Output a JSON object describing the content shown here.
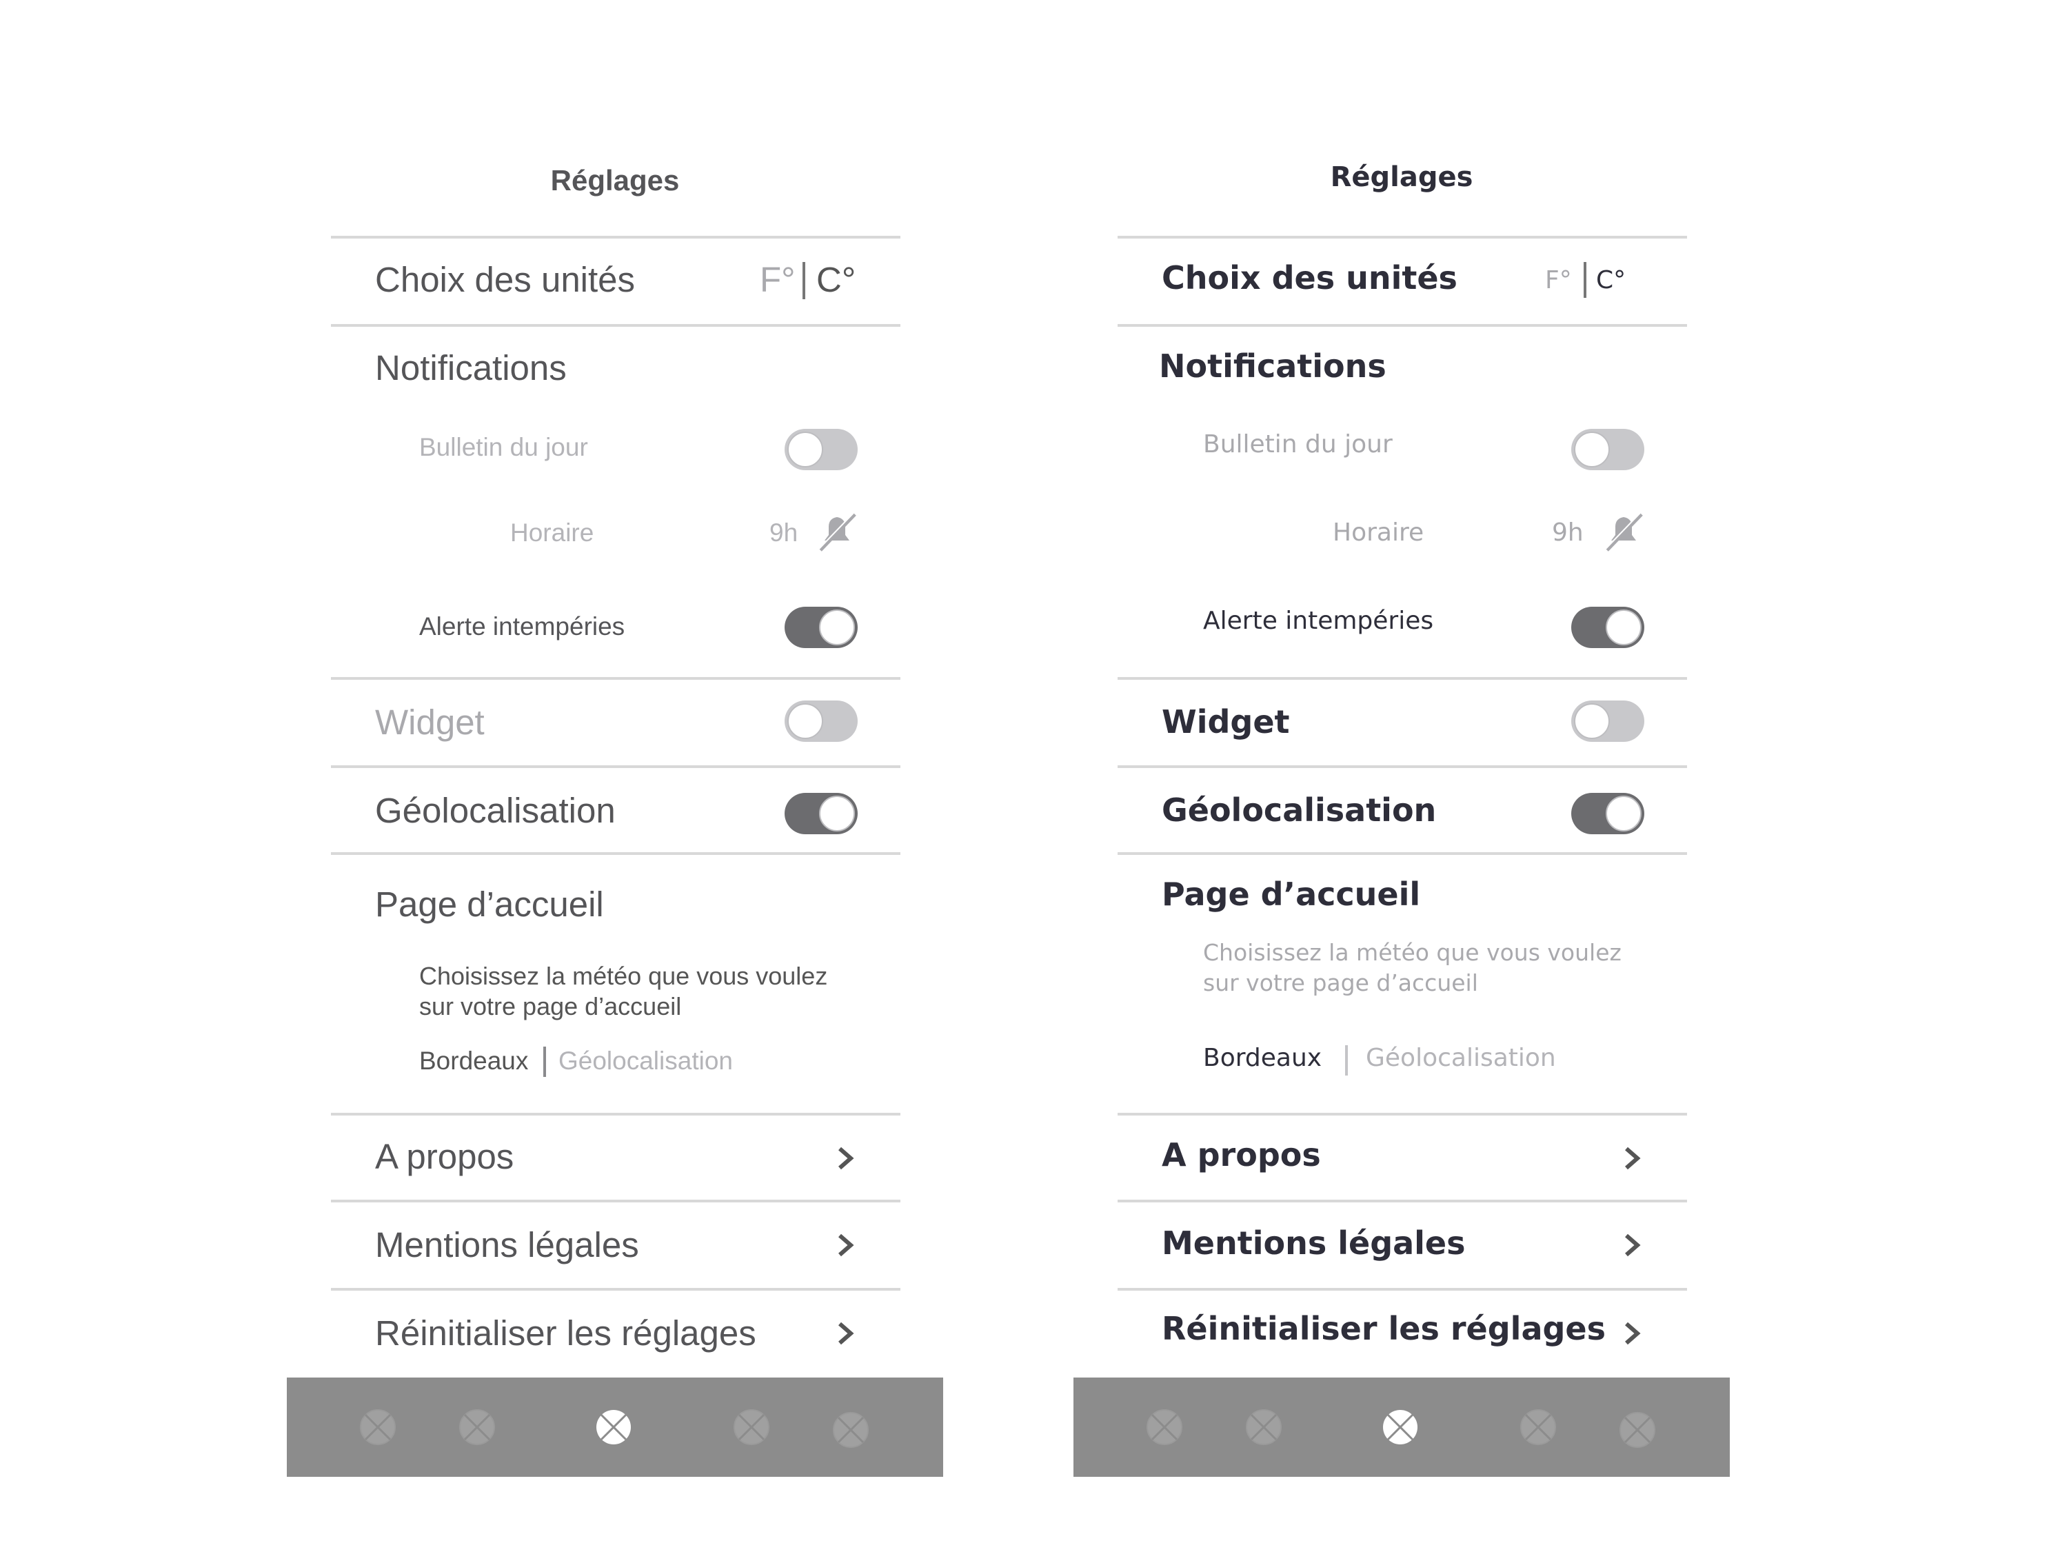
{
  "screens": [
    {
      "title": "Réglages",
      "units": {
        "label": "Choix des unités",
        "fahrenheit": "F°",
        "celsius": "C°"
      },
      "notifications": {
        "label": "Notifications",
        "daily": {
          "label": "Bulletin du jour",
          "on": false
        },
        "schedule": {
          "label": "Horaire",
          "value": "9h",
          "icon": "bell-off-icon"
        },
        "weather_alert": {
          "label": "Alerte intempéries",
          "on": true
        }
      },
      "widget": {
        "label": "Widget",
        "on": false
      },
      "geolocation": {
        "label": "Géolocalisation",
        "on": true
      },
      "homepage": {
        "label": "Page d’accueil",
        "description": "Choisissez la météo que vous voulez sur votre page d’accueil",
        "option_city": "Bordeaux",
        "option_geo": "Géolocalisation"
      },
      "links": [
        "A propos",
        "Mentions légales",
        "Réinitialiser les réglages"
      ],
      "tabbar": {
        "active_index": 2,
        "count": 5,
        "icon": "placeholder-x-icon"
      }
    },
    {
      "title": "Réglages",
      "units": {
        "label": "Choix des unités",
        "fahrenheit": "F°",
        "celsius": "C°"
      },
      "notifications": {
        "label": "Notifications",
        "daily": {
          "label": "Bulletin du jour",
          "on": false
        },
        "schedule": {
          "label": "Horaire",
          "value": "9h",
          "icon": "bell-off-icon"
        },
        "weather_alert": {
          "label": "Alerte intempéries",
          "on": true
        }
      },
      "widget": {
        "label": "Widget",
        "on": false
      },
      "geolocation": {
        "label": "Géolocalisation",
        "on": true
      },
      "homepage": {
        "label": "Page d’accueil",
        "description": "Choisissez la météo que vous voulez sur votre page d’accueil",
        "option_city": "Bordeaux",
        "option_geo": "Géolocalisation"
      },
      "links": [
        "A propos",
        "Mentions légales",
        "Réinitialiser les réglages"
      ],
      "tabbar": {
        "active_index": 2,
        "count": 5,
        "icon": "placeholder-x-icon"
      }
    }
  ],
  "colors": {
    "separator": "#d8d8d8",
    "toggle_on": "#6c6c6f",
    "toggle_off": "#c8c8cb",
    "tabbar": "#8c8c8c",
    "tab_inactive": "#a0a0a0",
    "tab_active": "#ffffff"
  }
}
